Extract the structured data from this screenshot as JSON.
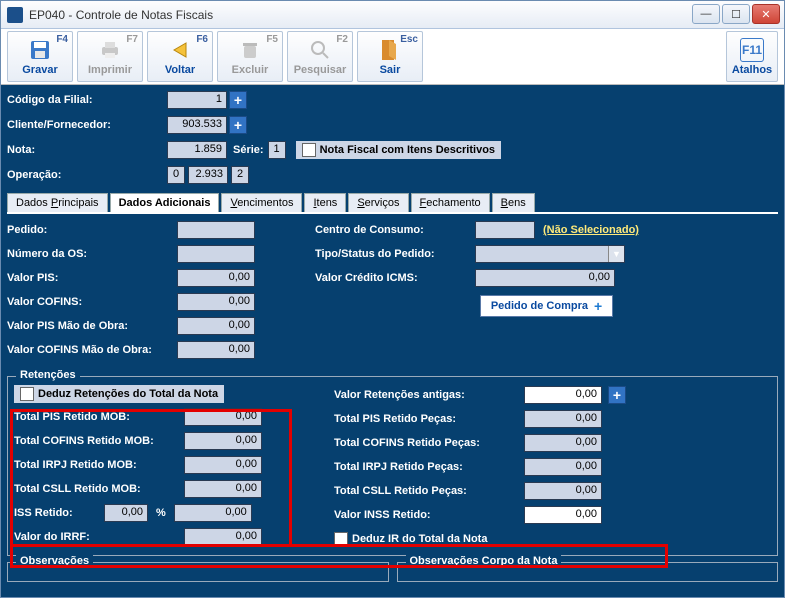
{
  "window": {
    "title": "EP040 - Controle de Notas Fiscais"
  },
  "toolbar": {
    "gravar": {
      "label": "Gravar",
      "key": "F4"
    },
    "imprimir": {
      "label": "Imprimir",
      "key": "F7"
    },
    "voltar": {
      "label": "Voltar",
      "key": "F6"
    },
    "excluir": {
      "label": "Excluir",
      "key": "F5"
    },
    "pesquisar": {
      "label": "Pesquisar",
      "key": "F2"
    },
    "sair": {
      "label": "Sair",
      "key": "Esc"
    },
    "atalhos": {
      "label": "Atalhos",
      "key": "F11"
    }
  },
  "header": {
    "filial_label": "Código da Filial:",
    "filial_value": "1",
    "cliente_label": "Cliente/Fornecedor:",
    "cliente_value": "903.533",
    "nota_label": "Nota:",
    "nota_value": "1.859",
    "serie_label": "Série:",
    "serie_value": "1",
    "nf_descritivos_label": "Nota Fiscal com Itens Descritivos",
    "operacao_label": "Operação:",
    "op_a": "0",
    "op_b": "2.933",
    "op_c": "2"
  },
  "tabs": {
    "principais": "Dados Principais",
    "adicionais": "Dados Adicionais",
    "venc": "Vencimentos",
    "itens": "Itens",
    "serv": "Serviços",
    "fech": "Fechamento",
    "bens": "Bens"
  },
  "left": {
    "pedido_label": "Pedido:",
    "pedido_value": "",
    "numos_label": "Número da OS:",
    "numos_value": "",
    "valorpis_label": "Valor PIS:",
    "valorpis_value": "0,00",
    "valorcofins_label": "Valor COFINS:",
    "valorcofins_value": "0,00",
    "valorpis_mo_label": "Valor PIS Mão de Obra:",
    "valorpis_mo_value": "0,00",
    "valorcofins_mo_label": "Valor COFINS Mão de Obra:",
    "valorcofins_mo_value": "0,00"
  },
  "right": {
    "centro_label": "Centro de Consumo:",
    "centro_value": "(Não Selecionado)",
    "tipo_label": "Tipo/Status do Pedido:",
    "tipo_value": "",
    "credito_label": "Valor Crédito ICMS:",
    "credito_value": "0,00",
    "pedido_btn": "Pedido de Compra"
  },
  "ret": {
    "group_title": "Retenções",
    "deduz_label": "Deduz Retenções do Total da Nota",
    "pis_mob_label": "Total PIS Retido MOB:",
    "pis_mob_val": "0,00",
    "cofins_mob_label": "Total COFINS Retido MOB:",
    "cofins_mob_val": "0,00",
    "irpj_mob_label": "Total IRPJ Retido MOB:",
    "irpj_mob_val": "0,00",
    "csll_mob_label": "Total CSLL Retido MOB:",
    "csll_mob_val": "0,00",
    "iss_label": "ISS Retido:",
    "iss_pct": "0,00",
    "pct_sign": "%",
    "iss_val": "0,00",
    "irrf_label": "Valor do IRRF:",
    "irrf_val": "0,00",
    "antigas_label": "Valor Retenções antigas:",
    "antigas_val": "0,00",
    "pis_pecas_label": "Total PIS Retido Peças:",
    "pis_pecas_val": "0,00",
    "cofins_pecas_label": "Total COFINS Retido Peças:",
    "cofins_pecas_val": "0,00",
    "irpj_pecas_label": "Total IRPJ Retido Peças:",
    "irpj_pecas_val": "0,00",
    "csll_pecas_label": "Total CSLL Retido Peças:",
    "csll_pecas_val": "0,00",
    "inss_label": "Valor INSS Retido:",
    "inss_val": "0,00",
    "deduz_ir_label": "Deduz IR do Total da Nota"
  },
  "obs": {
    "obs_title": "Observações",
    "obs_corpo_title": "Observações Corpo da Nota"
  }
}
